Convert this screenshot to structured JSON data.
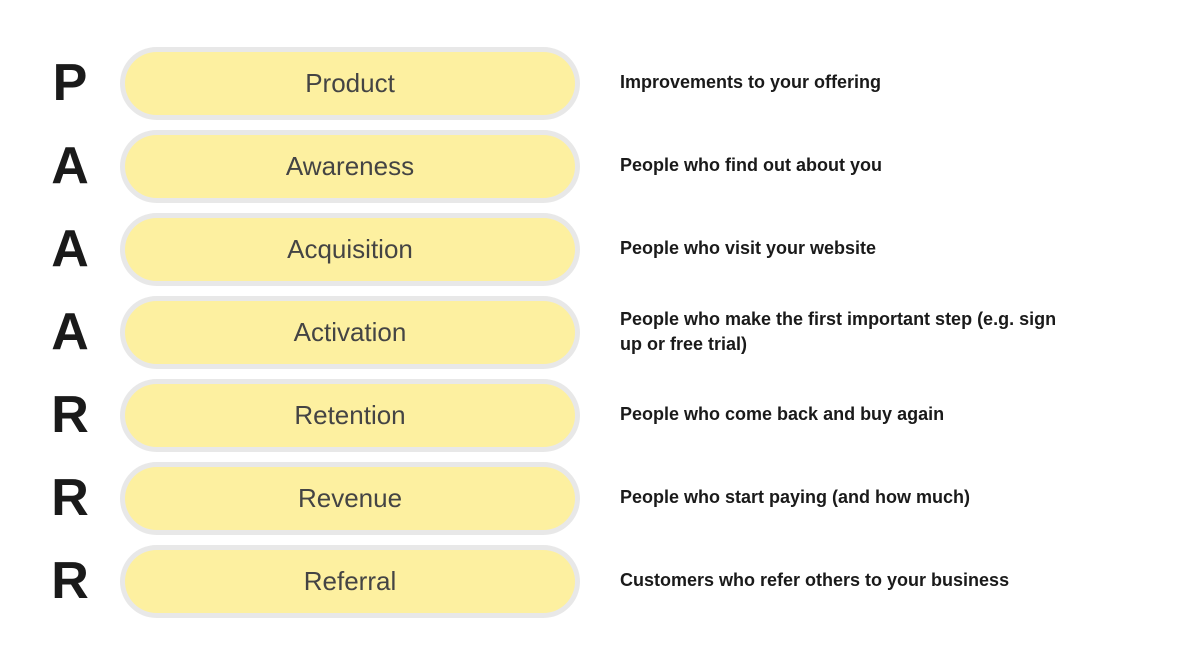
{
  "rows": [
    {
      "letter": "P",
      "pill_label": "Product",
      "description": "Improvements to your offering"
    },
    {
      "letter": "A",
      "pill_label": "Awareness",
      "description": "People who find out about you"
    },
    {
      "letter": "A",
      "pill_label": "Acquisition",
      "description": "People who visit your website"
    },
    {
      "letter": "A",
      "pill_label": "Activation",
      "description": "People who make the first important step (e.g. sign up or free trial)"
    },
    {
      "letter": "R",
      "pill_label": "Retention",
      "description": "People who come back and buy again"
    },
    {
      "letter": "R",
      "pill_label": "Revenue",
      "description": "People who start paying (and how much)"
    },
    {
      "letter": "R",
      "pill_label": "Referral",
      "description": "Customers who refer others to your business"
    }
  ]
}
